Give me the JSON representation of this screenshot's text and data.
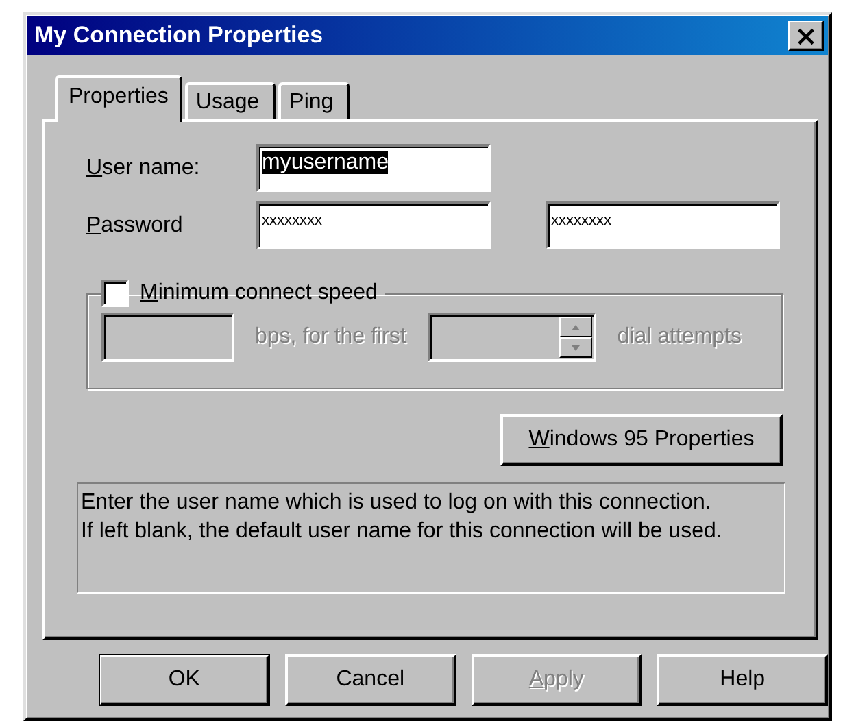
{
  "window": {
    "title": "My Connection Properties",
    "close": "×"
  },
  "tabs": [
    {
      "label": "Properties",
      "selected": true
    },
    {
      "label": "Usage",
      "selected": false
    },
    {
      "label": "Ping",
      "selected": false
    }
  ],
  "fields": [
    {
      "label": {
        "key": "U",
        "rest": "ser name:"
      },
      "inputs": [
        {
          "value": "myusername",
          "text_selected": true
        }
      ]
    },
    {
      "label": {
        "key": "P",
        "rest": "assword"
      },
      "inputs": [
        {
          "value": "xxxxxxxx",
          "text_selected": false
        },
        {
          "value": "xxxxxxxx",
          "text_selected": false
        }
      ]
    }
  ],
  "min_speed": {
    "label": {
      "key": "M",
      "rest": "inimum connect speed"
    },
    "checked": false,
    "disabled": true,
    "bps_text": "bps, for the first",
    "attempts_text": "dial attempts"
  },
  "win95_button": {
    "key": "W",
    "rest": "indows 95 Properties"
  },
  "info_text": [
    "Enter the user name which is used to log on with this connection.",
    "If left blank, the default user name for this connection will be used."
  ],
  "buttons": [
    {
      "label": {
        "rest": "OK"
      },
      "default": true,
      "disabled": false
    },
    {
      "label": {
        "rest": "Cancel"
      },
      "default": false,
      "disabled": false
    },
    {
      "label": {
        "key": "A",
        "rest": "pply"
      },
      "default": false,
      "disabled": true
    },
    {
      "label": {
        "rest": "Help"
      },
      "default": false,
      "disabled": false
    }
  ]
}
